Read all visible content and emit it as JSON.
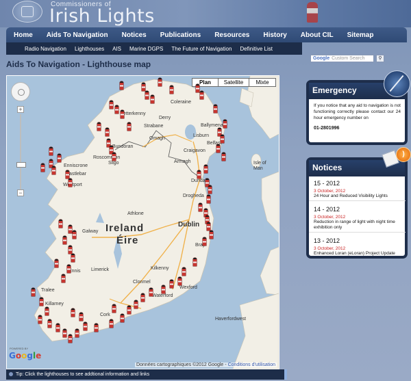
{
  "header": {
    "org_small": "Commissioners of",
    "org_big": "Irish Lights"
  },
  "nav": {
    "main": [
      "Home",
      "Aids To Navigation",
      "Notices",
      "Publications",
      "Resources",
      "History",
      "About CIL",
      "Sitemap"
    ],
    "sub": [
      "Radio Navigation",
      "Lighthouses",
      "AIS",
      "Marine DGPS",
      "The Future of Navigation",
      "Definitive List"
    ]
  },
  "search": {
    "placeholder": "Custom Search",
    "google": "Google",
    "button_icon": "search-icon"
  },
  "page": {
    "title": "Aids To Navigation - Lighthouse map"
  },
  "map": {
    "types": [
      "Plan",
      "Satellite",
      "Mixte"
    ],
    "active_type": "Plan",
    "country_labels": [
      "Ireland",
      "Éire"
    ],
    "cities": [
      {
        "name": "Coleraine"
      },
      {
        "name": "Ballymena"
      },
      {
        "name": "Derry"
      },
      {
        "name": "Letterkenny"
      },
      {
        "name": "Belfast"
      },
      {
        "name": "Isle of Man"
      },
      {
        "name": "Dundalk"
      },
      {
        "name": "Drogheda"
      },
      {
        "name": "Sligo"
      },
      {
        "name": "Enniscrone"
      },
      {
        "name": "Westport"
      },
      {
        "name": "Ennis"
      },
      {
        "name": "Galway"
      },
      {
        "name": "Athlone"
      },
      {
        "name": "Limerick"
      },
      {
        "name": "Dublin"
      },
      {
        "name": "Bray"
      },
      {
        "name": "Tralee"
      },
      {
        "name": "Killarney"
      },
      {
        "name": "Cork"
      },
      {
        "name": "Waterford"
      },
      {
        "name": "Wexford"
      },
      {
        "name": "Clonmel"
      },
      {
        "name": "Kilkenny"
      },
      {
        "name": "Haverfordwest"
      },
      {
        "name": "Armagh"
      },
      {
        "name": "Craigavon"
      },
      {
        "name": "Omagh"
      },
      {
        "name": "Strabane"
      },
      {
        "name": "Bundoran"
      },
      {
        "name": "Roscommon"
      },
      {
        "name": "Castlebar"
      },
      {
        "name": "Lisburn"
      }
    ],
    "lighthouse_count": 75,
    "powered_by": "POWERED BY",
    "google_logo": "Google",
    "credit": "Données cartographiques ©2012 Google -",
    "credit_link": "Conditions d'utilisation"
  },
  "tip": {
    "text": "Tip: Click the lighthouses to see addtional information and links"
  },
  "emergency": {
    "title": "Emergency",
    "text": "If you notice that any aid to navigation is not functioning correctly please contact our 24 hour emergency number on",
    "phone": "01-2801996"
  },
  "notices": {
    "title": "Notices",
    "items": [
      {
        "number": "15 - 2012",
        "date": "3 October, 2012",
        "title": "24 Hour and Reduced Visibility Lights"
      },
      {
        "number": "14 - 2012",
        "date": "3 October, 2012",
        "title": "Reduction in range of light with night time exhibition only"
      },
      {
        "number": "13 - 2012",
        "date": "3 October, 2012",
        "title": "Enhanced Loran (eLoran) Project Update"
      }
    ]
  },
  "colors": {
    "navy": "#1d2d49",
    "nav_blue": "#3e5a87",
    "notice_date_red": "#c92121",
    "sea": "#a8c3dc",
    "land": "#f2efe6"
  }
}
